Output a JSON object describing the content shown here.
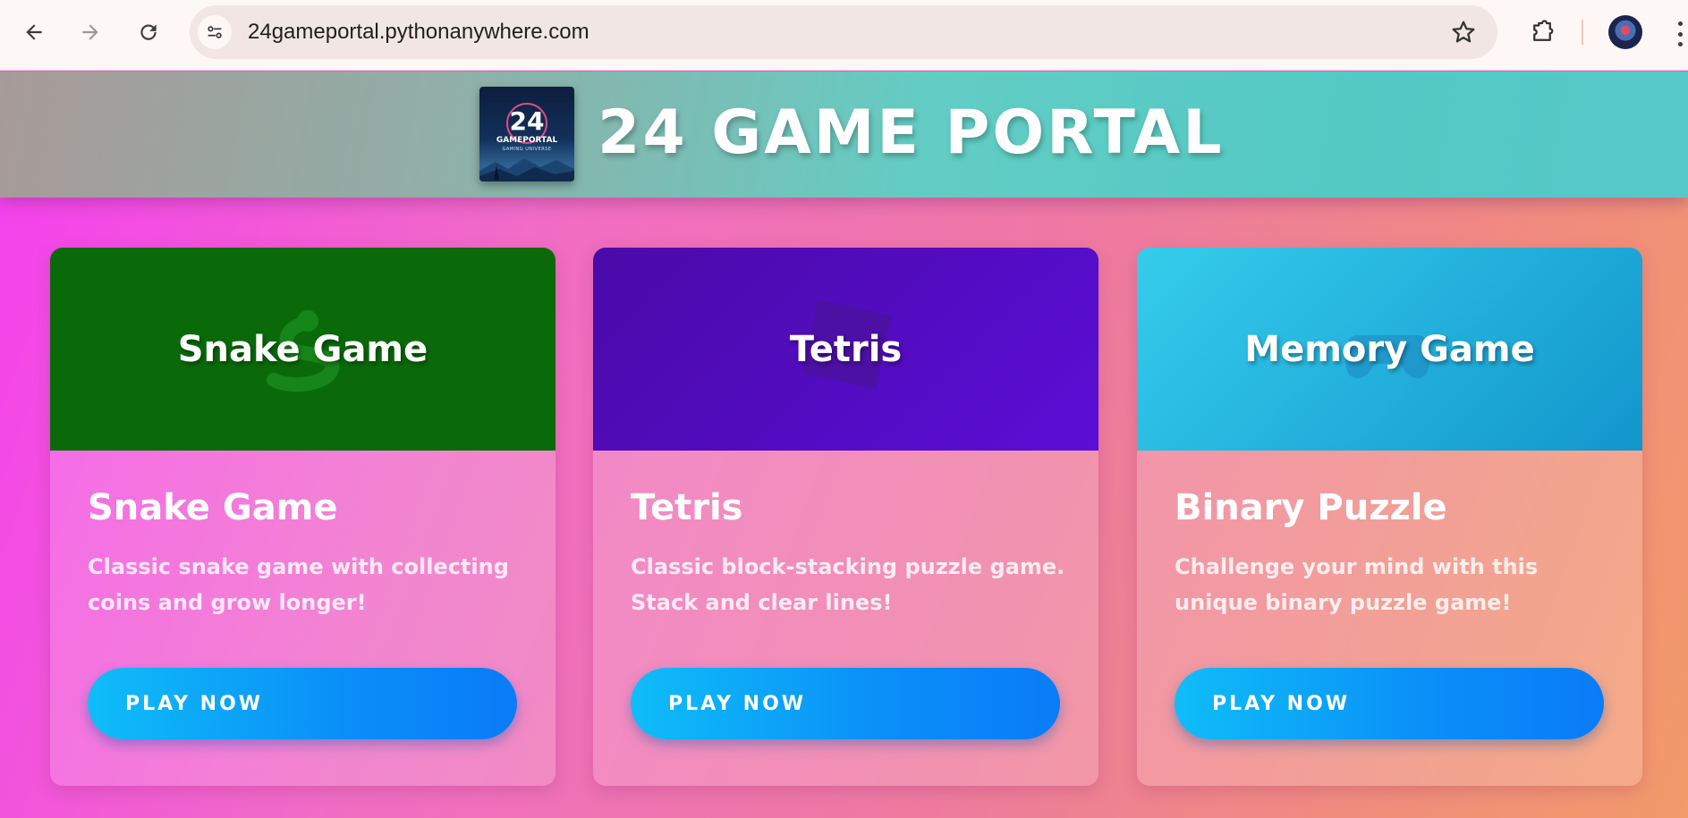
{
  "browser": {
    "url": "24gameportal.pythonanywhere.com",
    "icons": [
      "back-arrow-icon",
      "forward-arrow-icon",
      "reload-icon",
      "site-info-icon",
      "bookmark-star-icon",
      "extensions-icon",
      "profile-avatar",
      "more-menu-icon"
    ]
  },
  "header": {
    "title": "24 GAME PORTAL",
    "logo": {
      "number": "24",
      "word": "GAMEPORTAL",
      "tagline": "GAMING UNIVERSE"
    }
  },
  "cards": [
    {
      "banner_title": "Snake Game",
      "banner_icon": "snake-icon",
      "title": "Snake Game",
      "description": "Classic snake game with collecting coins and grow longer!",
      "button": "PLAY NOW"
    },
    {
      "banner_title": "Tetris",
      "banner_icon": "tetris-block-icon",
      "title": "Tetris",
      "description": "Classic block-stacking puzzle game. Stack and clear lines!",
      "button": "PLAY NOW"
    },
    {
      "banner_title": "Memory Game",
      "banner_icon": "gamepad-icon",
      "title": "Binary Puzzle",
      "description": "Challenge your mind with this unique binary puzzle game!",
      "button": "PLAY NOW"
    }
  ],
  "colors": {
    "snake_banner": "#0a6a0a",
    "tetris_banner": "#5510c8",
    "memory_banner": "#22b8e3",
    "button_gradient": [
      "#0fbdf8",
      "#0a7cf7"
    ]
  }
}
